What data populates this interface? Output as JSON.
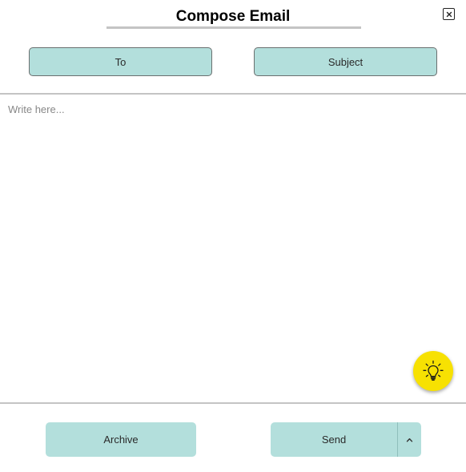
{
  "dialog": {
    "title": "Compose Email"
  },
  "fields": {
    "to_label": "To",
    "subject_label": "Subject"
  },
  "editor": {
    "placeholder": "Write here...",
    "value": ""
  },
  "actions": {
    "archive_label": "Archive",
    "send_label": "Send"
  },
  "icons": {
    "close": "close-icon",
    "idea": "lightbulb-icon",
    "send_options": "chevron-up-icon"
  },
  "colors": {
    "button_bg": "#b3dfdc",
    "idea_bg": "#f7e102",
    "divider": "#c4c4c4"
  }
}
